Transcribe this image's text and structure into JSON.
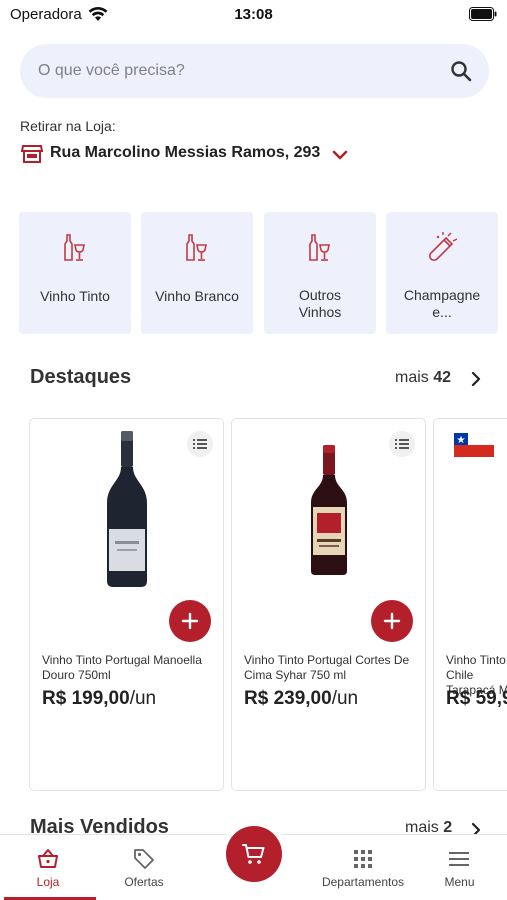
{
  "status_bar": {
    "carrier": "Operadora",
    "time": "13:08"
  },
  "search": {
    "placeholder": "O que você precisa?"
  },
  "pickup": {
    "label": "Retirar na Loja:",
    "address": "Rua Marcolino Messias Ramos, 293"
  },
  "categories": [
    {
      "label": "Vinho Tinto",
      "icon": "wine-bottle-glass-icon"
    },
    {
      "label": "Vinho Branco",
      "icon": "wine-bottle-glass-icon"
    },
    {
      "label": "Outros Vinhos",
      "icon": "wine-bottle-glass-icon"
    },
    {
      "label": "Champagne e...",
      "icon": "champagne-icon"
    }
  ],
  "featured": {
    "title": "Destaques",
    "more_label": "mais",
    "more_count": "42",
    "products": [
      {
        "name": "Vinho Tinto Portugal Manoella Douro 750ml",
        "price": "R$ 199,00",
        "unit": "/un"
      },
      {
        "name": "Vinho Tinto Portugal Cortes De Cima Syhar 750 ml",
        "price": "R$ 239,00",
        "unit": "/un"
      },
      {
        "name": "Vinho Tinto Chile Tarapacá M",
        "price": "R$ 59,9",
        "unit": ""
      }
    ]
  },
  "best_sellers": {
    "title": "Mais Vendidos",
    "more_label": "mais",
    "more_count": "2"
  },
  "tabs": [
    {
      "label": "Loja",
      "icon": "basket-icon",
      "active": true
    },
    {
      "label": "Ofertas",
      "icon": "tag-icon",
      "active": false
    },
    {
      "label": "Departamentos",
      "icon": "grid-icon",
      "active": false
    },
    {
      "label": "Menu",
      "icon": "menu-icon",
      "active": false
    }
  ],
  "colors": {
    "accent": "#b3202c",
    "surface": "#eef0fb"
  }
}
